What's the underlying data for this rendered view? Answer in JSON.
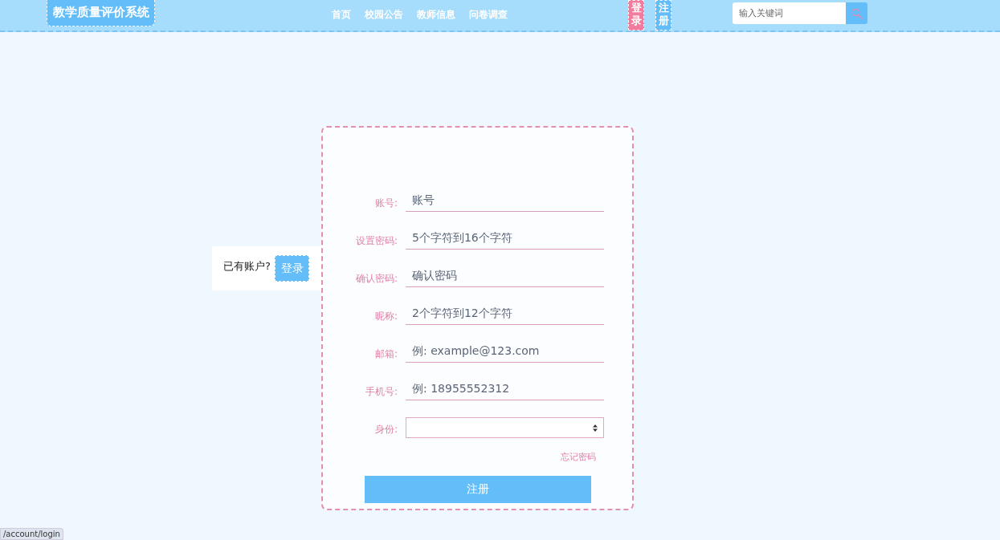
{
  "header": {
    "logo": "教学质量评价系统",
    "nav": [
      "首页",
      "校园公告",
      "教师信息",
      "问卷调查"
    ],
    "auth_buttons": [
      {
        "label": "登录",
        "kind": "login"
      },
      {
        "label": "注册",
        "kind": "register"
      }
    ],
    "search": {
      "placeholder": "输入关键词"
    }
  },
  "side": {
    "text": "已有账户?",
    "button": "登录"
  },
  "form": {
    "fields": [
      {
        "label": "账号:",
        "placeholder": "账号",
        "kind": "input"
      },
      {
        "label": "设置密码:",
        "placeholder": "5个字符到16个字符",
        "kind": "input"
      },
      {
        "label": "确认密码:",
        "placeholder": "确认密码",
        "kind": "input"
      },
      {
        "label": "昵称:",
        "placeholder": "2个字符到12个字符",
        "kind": "input"
      },
      {
        "label": "邮箱:",
        "placeholder": "例: example@123.com",
        "kind": "input"
      },
      {
        "label": "手机号:",
        "placeholder": "例: 18955552312",
        "kind": "input"
      },
      {
        "label": "身份:",
        "kind": "select"
      }
    ],
    "forgot": "忘记密码",
    "submit": "注册"
  },
  "status_bar": "/account/login"
}
